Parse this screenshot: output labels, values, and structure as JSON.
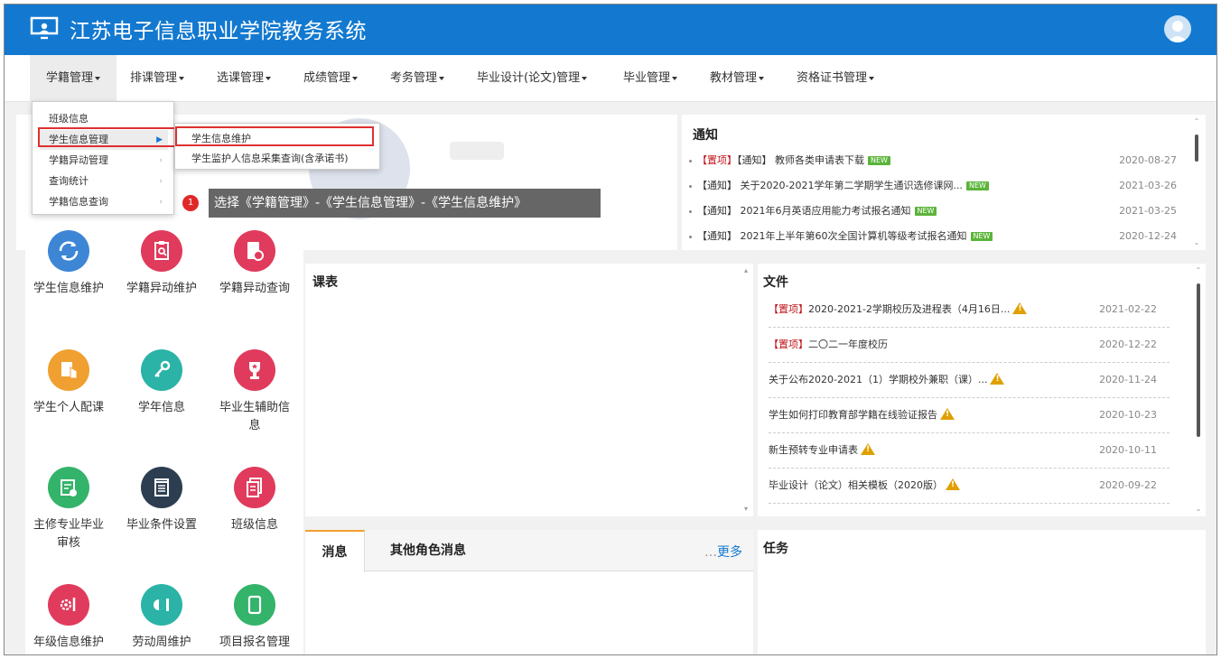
{
  "app": {
    "title": "江苏电子信息职业学院教务系统"
  },
  "nav": {
    "items": [
      {
        "label": "学籍管理"
      },
      {
        "label": "排课管理"
      },
      {
        "label": "选课管理"
      },
      {
        "label": "成绩管理"
      },
      {
        "label": "考务管理"
      },
      {
        "label": "毕业设计(论文)管理"
      },
      {
        "label": "毕业管理"
      },
      {
        "label": "教材管理"
      },
      {
        "label": "资格证书管理"
      }
    ]
  },
  "dropdown": {
    "items": [
      {
        "label": "班级信息"
      },
      {
        "label": "学生信息管理"
      },
      {
        "label": "学籍异动管理"
      },
      {
        "label": "查询统计"
      },
      {
        "label": "学籍信息查询"
      }
    ],
    "submenu": [
      {
        "label": "学生信息维护"
      },
      {
        "label": "学生监护人信息采集查询(含承诺书)"
      }
    ]
  },
  "guide": {
    "step": "1",
    "text": "选择《学籍管理》-《学生信息管理》-《学生信息维护》"
  },
  "tiles": [
    {
      "label": "学生信息维护",
      "icon": "refresh-key-icon",
      "color": "#3d86d6"
    },
    {
      "label": "学籍异动维护",
      "icon": "clipboard-search-icon",
      "color": "#e03b5c"
    },
    {
      "label": "学籍异动查询",
      "icon": "phone-book-icon",
      "color": "#e03b5c"
    },
    {
      "label": "学生个人配课",
      "icon": "hand-book-icon",
      "color": "#f0a030"
    },
    {
      "label": "学年信息",
      "icon": "key-icon",
      "color": "#2ab3a6"
    },
    {
      "label": "毕业生辅助信息",
      "icon": "trophy-icon",
      "color": "#e03b5c"
    },
    {
      "label": "主修专业毕业审核",
      "icon": "certificate-check-icon",
      "color": "#34b36a"
    },
    {
      "label": "毕业条件设置",
      "icon": "notebook-icon",
      "color": "#2c3e50"
    },
    {
      "label": "班级信息",
      "icon": "document-stack-icon",
      "color": "#e03b5c"
    },
    {
      "label": "年级信息维护",
      "icon": "gear-pencil-icon",
      "color": "#e03b5c"
    },
    {
      "label": "劳动周维护",
      "icon": "toggle-icon",
      "color": "#2ab3a6"
    },
    {
      "label": "项目报名管理",
      "icon": "tablet-icon",
      "color": "#34b36a"
    }
  ],
  "notice": {
    "title": "通知",
    "items": [
      {
        "tags": [
          "【置项】",
          "【通知】"
        ],
        "text": "教师各类申请表下载",
        "new": "NEW",
        "date": "2020-08-27"
      },
      {
        "tags": [
          "【通知】"
        ],
        "text": "关于2020-2021学年第二学期学生通识选修课网...",
        "new": "NEW",
        "date": "2021-03-26"
      },
      {
        "tags": [
          "【通知】"
        ],
        "text": "2021年6月英语应用能力考试报名通知",
        "new": "NEW",
        "date": "2021-03-25"
      },
      {
        "tags": [
          "【通知】"
        ],
        "text": "2021年上半年第60次全国计算机等级考试报名通知",
        "new": "NEW",
        "date": "2020-12-24"
      }
    ]
  },
  "schedule": {
    "title": "课表"
  },
  "files": {
    "title": "文件",
    "items": [
      {
        "tag": "【置项】",
        "text": "2020-2021-2学期校历及进程表（4月16日...",
        "warn": true,
        "date": "2021-02-22"
      },
      {
        "tag": "【置项】",
        "text": "二〇二一年度校历",
        "warn": false,
        "date": "2020-12-22"
      },
      {
        "tag": "",
        "text": "关于公布2020-2021（1）学期校外兼职（课）...",
        "warn": true,
        "date": "2020-11-24"
      },
      {
        "tag": "",
        "text": "学生如何打印教育部学籍在线验证报告",
        "warn": true,
        "date": "2020-10-23"
      },
      {
        "tag": "",
        "text": "新生预转专业申请表",
        "warn": true,
        "date": "2020-10-11"
      },
      {
        "tag": "",
        "text": "毕业设计（论文）相关模板（2020版）",
        "warn": true,
        "date": "2020-09-22"
      }
    ]
  },
  "messages": {
    "tabs": [
      {
        "label": "消息"
      },
      {
        "label": "其他角色消息"
      }
    ],
    "more": "更多"
  },
  "tasks": {
    "title": "任务"
  }
}
